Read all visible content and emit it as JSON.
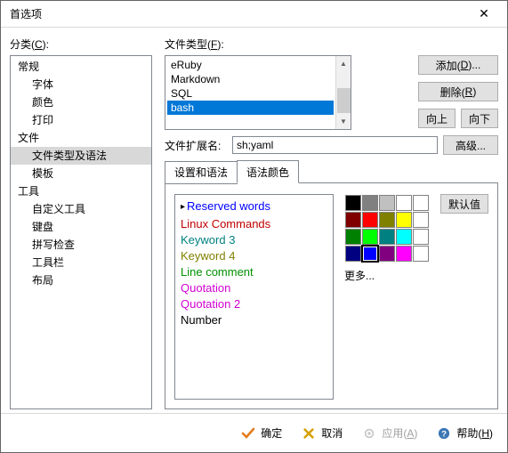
{
  "window": {
    "title": "首选项"
  },
  "left": {
    "label_pre": "分类(",
    "label_key": "C",
    "label_post": "):",
    "items": [
      {
        "label": "常规",
        "level": 0
      },
      {
        "label": "字体",
        "level": 1
      },
      {
        "label": "颜色",
        "level": 1
      },
      {
        "label": "打印",
        "level": 1
      },
      {
        "label": "文件",
        "level": 0
      },
      {
        "label": "文件类型及语法",
        "level": 1,
        "selected": true
      },
      {
        "label": "模板",
        "level": 1
      },
      {
        "label": "工具",
        "level": 0
      },
      {
        "label": "自定义工具",
        "level": 1
      },
      {
        "label": "键盘",
        "level": 1
      },
      {
        "label": "拼写检查",
        "level": 1
      },
      {
        "label": "工具栏",
        "level": 1
      },
      {
        "label": "布局",
        "level": 1
      }
    ]
  },
  "filetype": {
    "label_pre": "文件类型(",
    "label_key": "F",
    "label_post": "):",
    "items": [
      {
        "label": "eRuby"
      },
      {
        "label": "Markdown"
      },
      {
        "label": "SQL"
      },
      {
        "label": "bash",
        "selected": true
      }
    ]
  },
  "buttons": {
    "add_pre": "添加(",
    "add_key": "D",
    "add_post": ")...",
    "remove_pre": "删除(",
    "remove_key": "R",
    "remove_post": ")",
    "up": "向上",
    "down": "向下",
    "advanced": "高级...",
    "default": "默认值",
    "ok": "确定",
    "cancel": "取消",
    "apply_pre": "应用(",
    "apply_key": "A",
    "apply_post": ")",
    "help_pre": "帮助(",
    "help_key": "H",
    "help_post": ")"
  },
  "ext": {
    "label": "文件扩展名:",
    "value": "sh;yaml"
  },
  "tabs": {
    "settings": "设置和语法",
    "colors": "语法颜色"
  },
  "syntax_items": [
    {
      "label": "Reserved words",
      "color": "#0000ff",
      "marker": true
    },
    {
      "label": "Linux Commands",
      "color": "#c00000"
    },
    {
      "label": "Keyword 3",
      "color": "#008080"
    },
    {
      "label": "Keyword 4",
      "color": "#808000"
    },
    {
      "label": "Line comment",
      "color": "#009000"
    },
    {
      "label": "Quotation",
      "color": "#d000d0"
    },
    {
      "label": "Quotation 2",
      "color": "#d000d0"
    },
    {
      "label": "Number",
      "color": "#000000"
    }
  ],
  "palette": {
    "colors": [
      "#000000",
      "#808080",
      "#c0c0c0",
      "#ffffff",
      "#ffffff",
      "#800000",
      "#ff0000",
      "#808000",
      "#ffff00",
      "#ffffff",
      "#008000",
      "#00ff00",
      "#008080",
      "#00ffff",
      "#ffffff",
      "#000080",
      "#0000ff",
      "#800080",
      "#ff00ff",
      "#ffffff"
    ],
    "selected_index": 16,
    "more": "更多..."
  }
}
